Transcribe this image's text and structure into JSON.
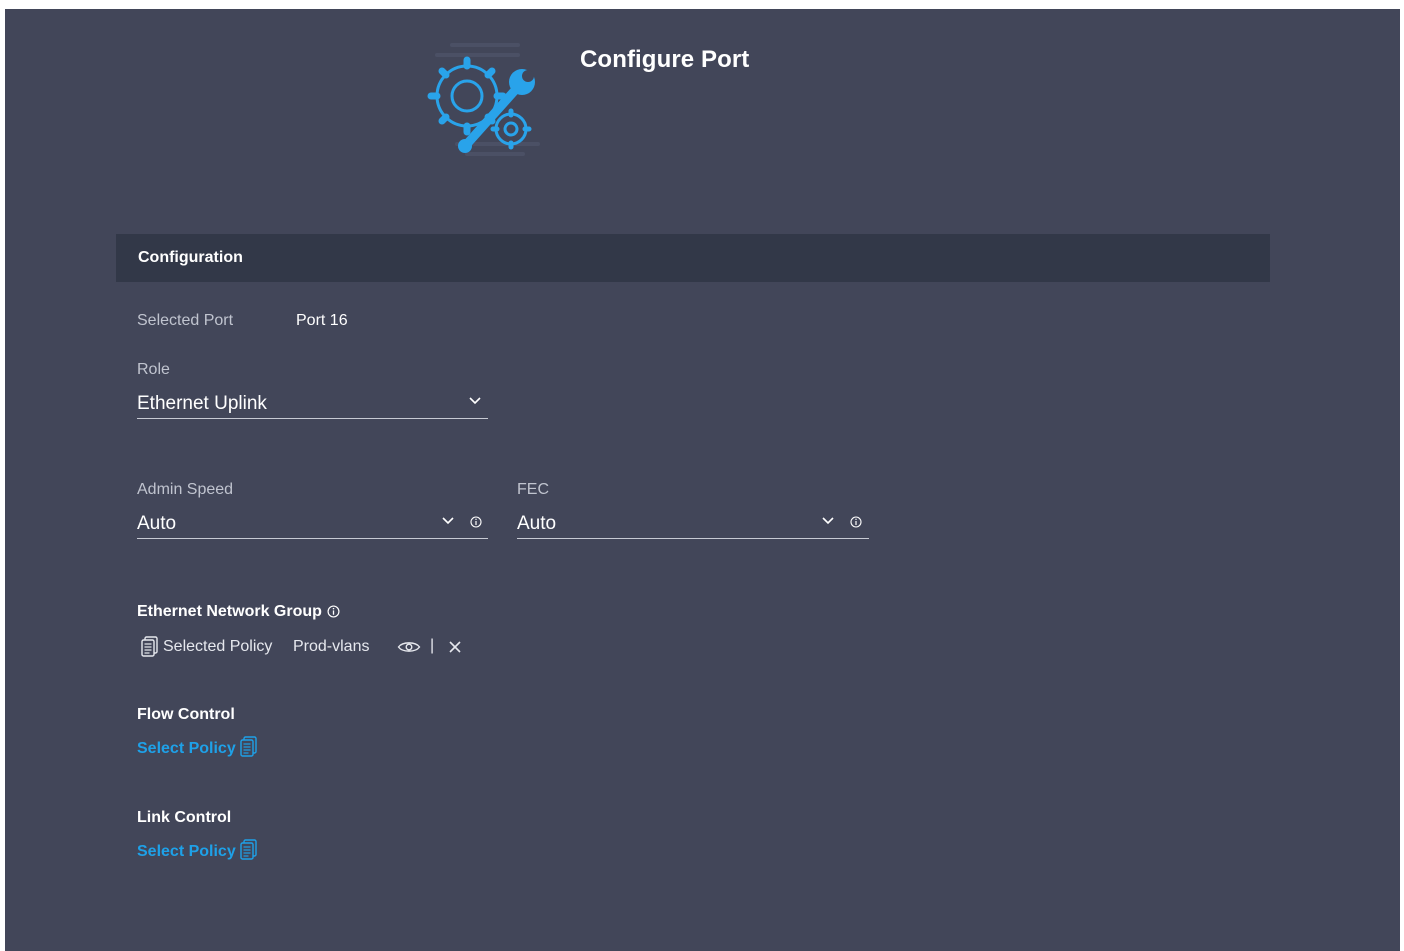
{
  "header": {
    "title": "Configure Port",
    "icon": "gear-wrench-icon"
  },
  "section": {
    "title": "Configuration"
  },
  "selected_port": {
    "label": "Selected Port",
    "value": "Port 16"
  },
  "role": {
    "label": "Role",
    "value": "Ethernet Uplink"
  },
  "admin_speed": {
    "label": "Admin Speed",
    "value": "Auto"
  },
  "fec": {
    "label": "FEC",
    "value": "Auto"
  },
  "ethernet_network_group": {
    "title": "Ethernet Network Group",
    "policy_label": "Selected Policy",
    "policy_value": "Prod-vlans",
    "separator": "|"
  },
  "flow_control": {
    "title": "Flow Control",
    "link": "Select Policy"
  },
  "link_control": {
    "title": "Link Control",
    "link": "Select Policy"
  },
  "colors": {
    "background": "#424659",
    "section_bar": "#323848",
    "accent": "#1ea1e8"
  }
}
